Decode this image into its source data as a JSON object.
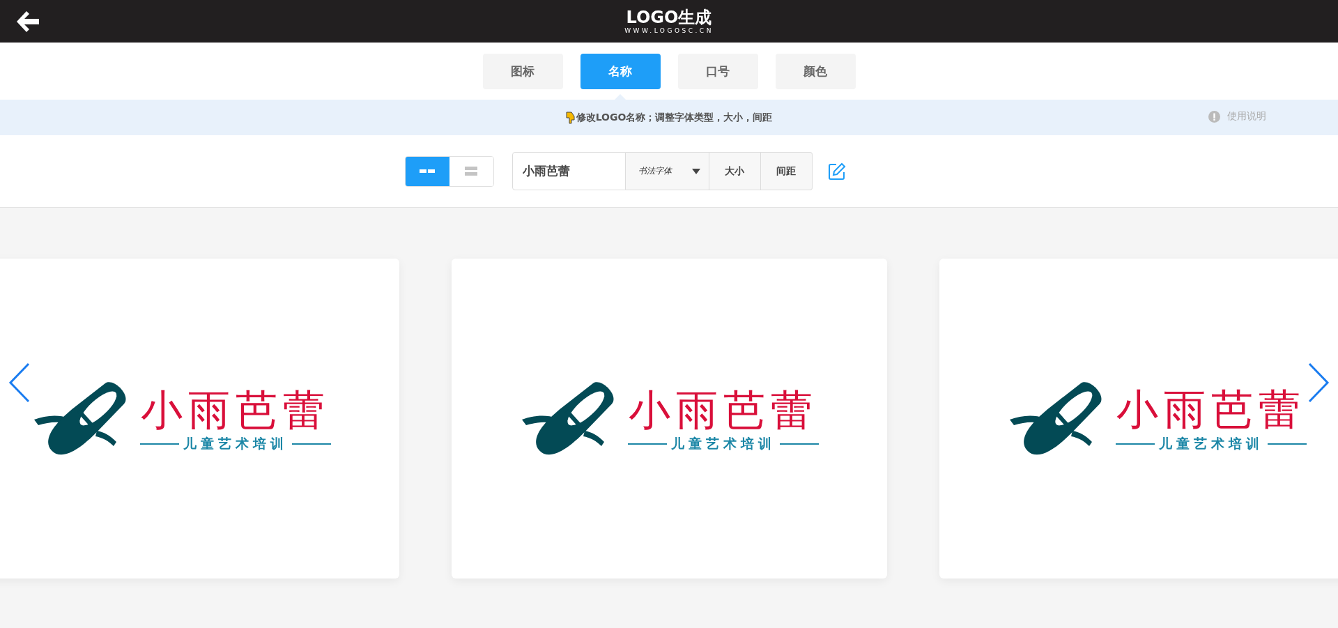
{
  "header": {
    "logo_title": "LOGO生成",
    "logo_url": "WWW.LOGOSC.CN"
  },
  "tabs": [
    {
      "label": "图标",
      "selected": false
    },
    {
      "label": "名称",
      "selected": true
    },
    {
      "label": "口号",
      "selected": false
    },
    {
      "label": "颜色",
      "selected": false
    }
  ],
  "hint": {
    "text": "修改LOGO名称；调整字体类型，大小，间距",
    "help": "使用说明"
  },
  "toolbar": {
    "layouts": [
      {
        "kind": "horizontal",
        "selected": true
      },
      {
        "kind": "vertical",
        "selected": false
      }
    ],
    "name_value": "小雨芭蕾",
    "font_select": "书法字体",
    "size_button": "大小",
    "spacing_button": "间距"
  },
  "cards": [
    {
      "name": "小雨芭蕾",
      "slogan": "儿童艺术培训",
      "kind": "seal"
    },
    {
      "name": "小雨芭蕾",
      "slogan": "儿童艺术培训",
      "kind": "round"
    },
    {
      "name": "小雨芭蕾",
      "slogan": "儿童艺术培训",
      "kind": "brush"
    }
  ]
}
